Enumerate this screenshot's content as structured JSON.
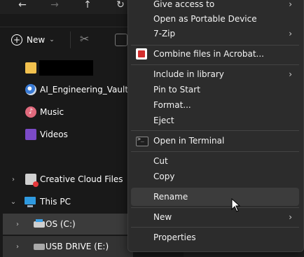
{
  "explorer": {
    "nav": {
      "back_glyph": "←",
      "forward_glyph": "→",
      "up_glyph": "↑",
      "refresh_glyph": "↻"
    },
    "command_bar": {
      "new_label": "New",
      "new_chevron": "⌄"
    },
    "tree": [
      {
        "label": "",
        "icon": "folder-icon",
        "redacted": true
      },
      {
        "label": "AI_Engineering_Vault",
        "icon": "vault-icon"
      },
      {
        "label": "Music",
        "icon": "music-icon"
      },
      {
        "label": "Videos",
        "icon": "videos-icon"
      },
      {
        "label": "Creative Cloud Files",
        "icon": "creative-cloud-icon"
      },
      {
        "label": "This PC",
        "icon": "pc-icon"
      },
      {
        "label": "OS (C:)",
        "icon": "drive-icon"
      },
      {
        "label": "USB DRIVE (E:)",
        "icon": "usb-drive-icon"
      }
    ]
  },
  "context_menu": {
    "items": [
      {
        "label": "Give access to",
        "submenu": true
      },
      {
        "label": "Open as Portable Device",
        "submenu": false
      },
      {
        "label": "7-Zip",
        "submenu": true
      },
      {
        "label": "Combine files in Acrobat...",
        "submenu": false,
        "icon": "acrobat-icon"
      },
      {
        "label": "Include in library",
        "submenu": true
      },
      {
        "label": "Pin to Start",
        "submenu": false
      },
      {
        "label": "Format...",
        "submenu": false
      },
      {
        "label": "Eject",
        "submenu": false
      },
      {
        "label": "Open in Terminal",
        "submenu": false,
        "icon": "terminal-icon"
      },
      {
        "label": "Cut",
        "submenu": false
      },
      {
        "label": "Copy",
        "submenu": false
      },
      {
        "label": "Rename",
        "submenu": false,
        "hovered": true
      },
      {
        "label": "New",
        "submenu": true
      },
      {
        "label": "Properties",
        "submenu": false
      }
    ],
    "submenu_glyph": "›"
  },
  "colors": {
    "menu_bg": "#2c2c2c",
    "hover_bg": "#3c3c3c",
    "explorer_bg": "#191919"
  }
}
